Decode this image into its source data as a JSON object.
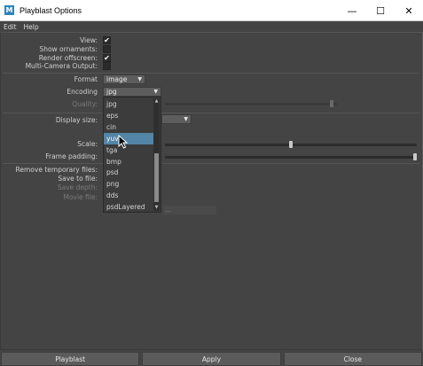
{
  "window": {
    "title": "Playblast Options",
    "app_icon_letter": "M",
    "minimize": "—",
    "maximize": "☐",
    "close": "✕"
  },
  "menu": [
    "Edit",
    "Help"
  ],
  "fields": {
    "view_label": "View:",
    "show_ornaments_label": "Show ornaments:",
    "render_offscreen_label": "Render offscreen:",
    "multi_camera_label": "Multi-Camera Output:",
    "format_label": "Format",
    "format_value": "image",
    "encoding_label": "Encoding",
    "encoding_value": "jpg",
    "quality_label": "Quality:",
    "display_size_label": "Display size:",
    "scale_label": "Scale:",
    "frame_padding_label": "Frame padding:",
    "remove_temp_label": "Remove temporary files:",
    "save_to_file_label": "Save to file:",
    "save_depth_label": "Save depth:",
    "movie_file_label": "Movie file:",
    "movie_file_value": "..."
  },
  "checks": {
    "view": true,
    "show_ornaments": false,
    "render_offscreen": true,
    "multi_camera": false
  },
  "encoding_options": [
    "jpg",
    "eps",
    "cin",
    "yuv",
    "tga",
    "bmp",
    "psd",
    "png",
    "dds",
    "psdLayered"
  ],
  "selected_option": "yuv",
  "sliders": {
    "quality_fraction": 0.98,
    "scale_fraction": 0.5,
    "frame_padding_fraction": 1.0
  },
  "buttons": {
    "playblast": "Playblast",
    "apply": "Apply",
    "close": "Close"
  },
  "colors": {
    "background": "#444444",
    "selection": "#5285a6"
  }
}
